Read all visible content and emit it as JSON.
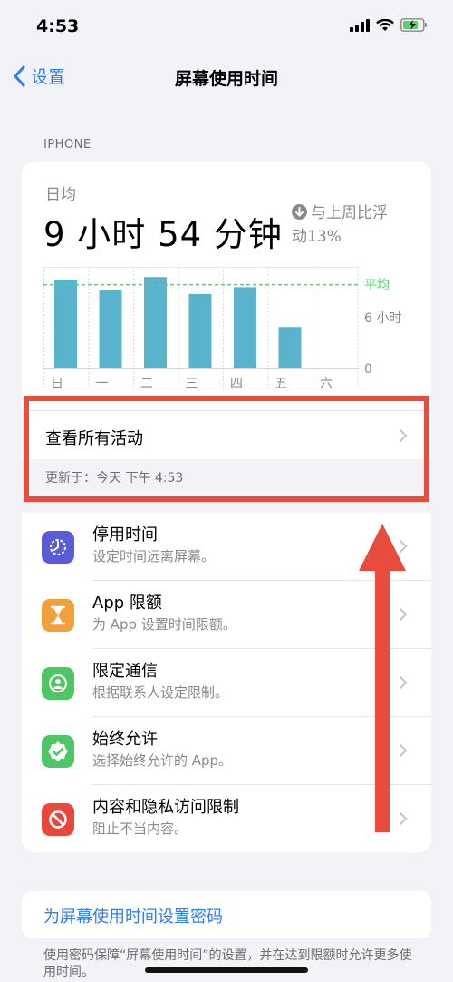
{
  "status": {
    "time": "4:53"
  },
  "nav": {
    "back_label": "设置",
    "title": "屏幕使用时间"
  },
  "section_label": "IPHONE",
  "summary": {
    "daily_label": "日均",
    "daily_value": "9 小时 54 分钟",
    "compare_line1": "与上周比浮",
    "compare_line2": "动13%"
  },
  "chart_data": {
    "type": "bar",
    "categories": [
      "日",
      "一",
      "二",
      "三",
      "四",
      "五",
      "六"
    ],
    "values": [
      10.5,
      9.3,
      10.8,
      8.8,
      9.6,
      4.9,
      0
    ],
    "ylim": [
      0,
      12
    ],
    "average": 9.9,
    "average_label": "平均",
    "y_tick_labels": [
      "6 小时",
      "0"
    ],
    "y_ticks": [
      6,
      0
    ],
    "bar_color": "#5ab3cd",
    "average_color": "#4cd964"
  },
  "activity": {
    "label": "查看所有活动",
    "updated": "更新于：今天 下午 4:53"
  },
  "list": [
    {
      "title": "停用时间",
      "subtitle": "设定时间远离屏幕。",
      "icon": "downtime-icon",
      "color": "#5b5bd6"
    },
    {
      "title": "App 限额",
      "subtitle": "为 App 设置时间限额。",
      "icon": "hourglass-icon",
      "color": "#f1a03b"
    },
    {
      "title": "限定通信",
      "subtitle": "根据联系人设定限制。",
      "icon": "contact-icon",
      "color": "#4cc764"
    },
    {
      "title": "始终允许",
      "subtitle": "选择始终允许的 App。",
      "icon": "checkmark-badge-icon",
      "color": "#4cc764"
    },
    {
      "title": "内容和隐私访问限制",
      "subtitle": "阻止不当内容。",
      "icon": "prohibit-icon",
      "color": "#e8483c"
    }
  ],
  "passcode": {
    "label": "为屏幕使用时间设置密码"
  },
  "footer": {
    "note": "使用密码保障“屏幕使用时间”的设置，并在达到限额时允许更多使用时间。"
  },
  "colors": {
    "accent": "#2f7cf6",
    "highlight": "#e74c3c"
  }
}
